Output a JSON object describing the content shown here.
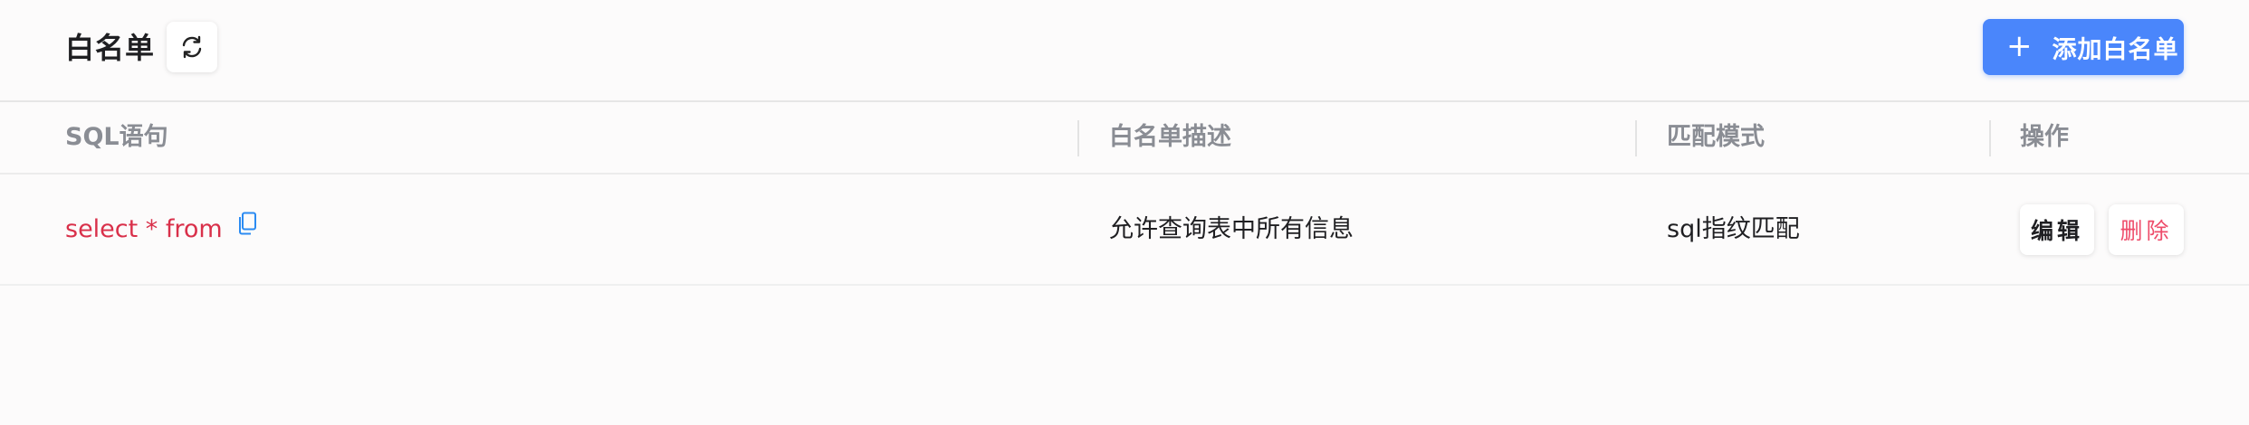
{
  "header": {
    "title": "白名单",
    "refresh_icon": "refresh-icon",
    "add_button": {
      "icon": "plus-icon",
      "icon_glyph": "+",
      "label": "添加白名单"
    }
  },
  "table": {
    "columns": [
      "SQL语句",
      "白名单描述",
      "匹配模式",
      "操作"
    ],
    "rows": [
      {
        "sql": "select * from",
        "copy_icon": "copy-icon",
        "description": "允许查询表中所有信息",
        "match_mode": "sql指纹匹配",
        "actions": {
          "edit": "编辑",
          "delete": "删除"
        }
      }
    ]
  },
  "colors": {
    "accent": "#4a86fb",
    "sql_text": "#d9304a",
    "delete_text": "#ee4d6b",
    "header_text": "#8a8d94"
  }
}
